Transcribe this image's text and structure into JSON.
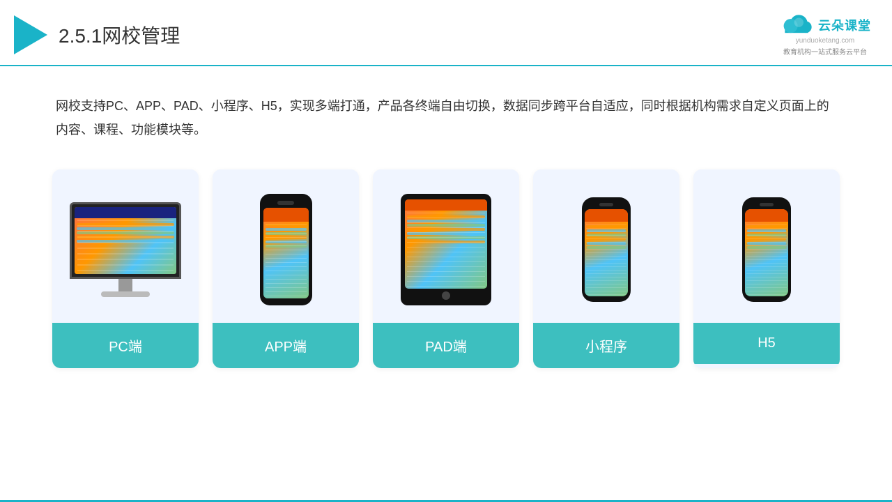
{
  "header": {
    "title_number": "2.5.1",
    "title_text": "网校管理",
    "logo_main": "云朵课堂",
    "logo_url": "yunduoketang.com",
    "logo_tagline": "教育机构一站式服务云平台"
  },
  "description": {
    "text": "网校支持PC、APP、PAD、小程序、H5，实现多端打通，产品各终端自由切换，数据同步跨平台自适应，同时根据机构需求自定义页面上的内容、课程、功能模块等。"
  },
  "cards": [
    {
      "id": "pc",
      "label": "PC端"
    },
    {
      "id": "app",
      "label": "APP端"
    },
    {
      "id": "pad",
      "label": "PAD端"
    },
    {
      "id": "miniapp",
      "label": "小程序"
    },
    {
      "id": "h5",
      "label": "H5"
    }
  ],
  "colors": {
    "accent": "#1ab3c8",
    "card_bg": "#f0f5ff",
    "card_label_bg": "#3dbfbf",
    "header_line": "#1ab3c8"
  }
}
